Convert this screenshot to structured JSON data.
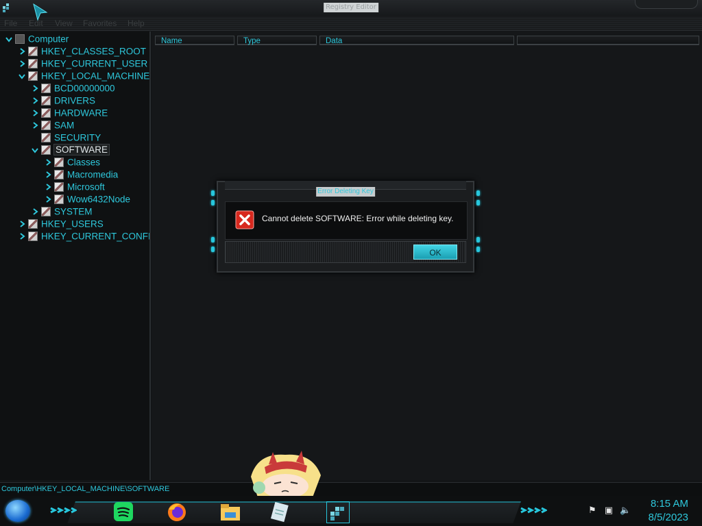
{
  "window": {
    "title": "Registry Editor"
  },
  "menu": {
    "items": [
      "File",
      "Edit",
      "View",
      "Favorites",
      "Help"
    ]
  },
  "tree": {
    "nodes": [
      {
        "label": "Computer",
        "level": 0,
        "expanded": true
      },
      {
        "label": "HKEY_CLASSES_ROOT",
        "level": 1,
        "expanded": false
      },
      {
        "label": "HKEY_CURRENT_USER",
        "level": 1,
        "expanded": false
      },
      {
        "label": "HKEY_LOCAL_MACHINE",
        "level": 1,
        "expanded": true
      },
      {
        "label": "BCD00000000",
        "level": 2,
        "expanded": false
      },
      {
        "label": "DRIVERS",
        "level": 2,
        "expanded": false
      },
      {
        "label": "HARDWARE",
        "level": 2,
        "expanded": false
      },
      {
        "label": "SAM",
        "level": 2,
        "expanded": false
      },
      {
        "label": "SECURITY",
        "level": 2,
        "expanded": null
      },
      {
        "label": "SOFTWARE",
        "level": 2,
        "expanded": true,
        "selected": true
      },
      {
        "label": "Classes",
        "level": 3,
        "expanded": false
      },
      {
        "label": "Macromedia",
        "level": 3,
        "expanded": false
      },
      {
        "label": "Microsoft",
        "level": 3,
        "expanded": false
      },
      {
        "label": "Wow6432Node",
        "level": 3,
        "expanded": false
      },
      {
        "label": "SYSTEM",
        "level": 2,
        "expanded": false
      },
      {
        "label": "HKEY_USERS",
        "level": 1,
        "expanded": false
      },
      {
        "label": "HKEY_CURRENT_CONFI",
        "level": 1,
        "expanded": false
      }
    ]
  },
  "list": {
    "columns": [
      "Name",
      "Type",
      "Data"
    ]
  },
  "dialog": {
    "title": "Error Deleting Key",
    "message": "Cannot delete SOFTWARE:  Error while deleting key.",
    "ok_label": "OK"
  },
  "status": {
    "path": "Computer\\HKEY_LOCAL_MACHINE\\SOFTWARE"
  },
  "taskbar": {
    "apps": [
      "spotify-icon",
      "firefox-icon",
      "file-explorer-icon",
      "notepad-icon",
      "registry-editor-icon"
    ],
    "tray": [
      "action-center-flag-icon",
      "network-icon",
      "volume-icon"
    ],
    "time": "8:15 AM",
    "date": "8/5/2023"
  },
  "colors": {
    "accent": "#2ec8dc",
    "background": "#131517",
    "error": "#d7281e"
  }
}
